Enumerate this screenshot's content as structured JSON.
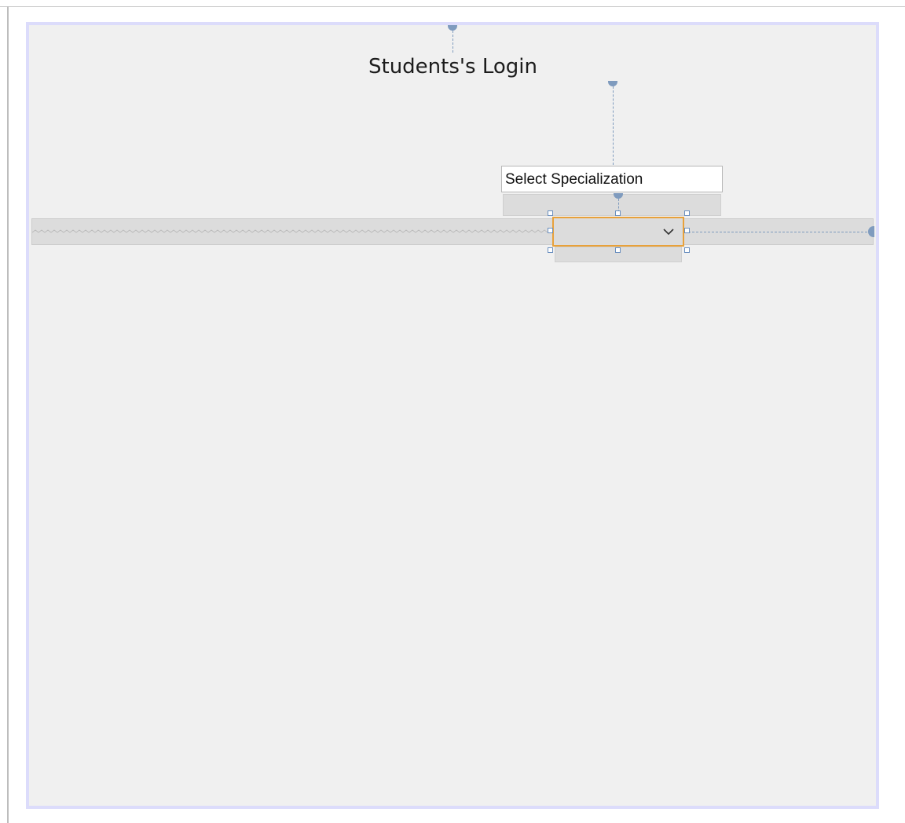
{
  "form": {
    "title": "Students's Login"
  },
  "label": {
    "text": "Select Specialization"
  },
  "combobox": {
    "value": "",
    "dropdown_icon": "chevron-down-icon"
  },
  "colors": {
    "surface": "#f0f0f0",
    "surface_border": "#dcdcfb",
    "selection": "#e8a13a",
    "snapline": "#7f9bbe"
  }
}
